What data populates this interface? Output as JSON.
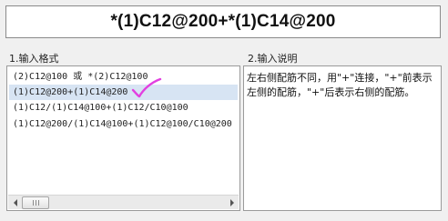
{
  "formula": "*(1)C12@200+*(1)C14@200",
  "left_panel": {
    "title": "1.输入格式",
    "items": [
      "(2)C12@100 或 *(2)C12@100",
      "(1)C12@200+(1)C14@200",
      "(1)C12/(1)C14@100+(1)C12/C10@100",
      "(1)C12@200/(1)C14@100+(1)C12@100/C10@200"
    ],
    "selected_index": 1
  },
  "right_panel": {
    "title": "2.输入说明",
    "text": "左右侧配筋不同，用\"+\"连接，\"+\"前表示左侧的配筋，\"+\"后表示右侧的配筋。"
  },
  "colors": {
    "selection": "#d7e4f3",
    "checkmark": "#e23fe0"
  },
  "icons": {
    "checkmark": "checkmark-annotation",
    "scroll_left": "triangle-left",
    "scroll_right": "triangle-right"
  }
}
